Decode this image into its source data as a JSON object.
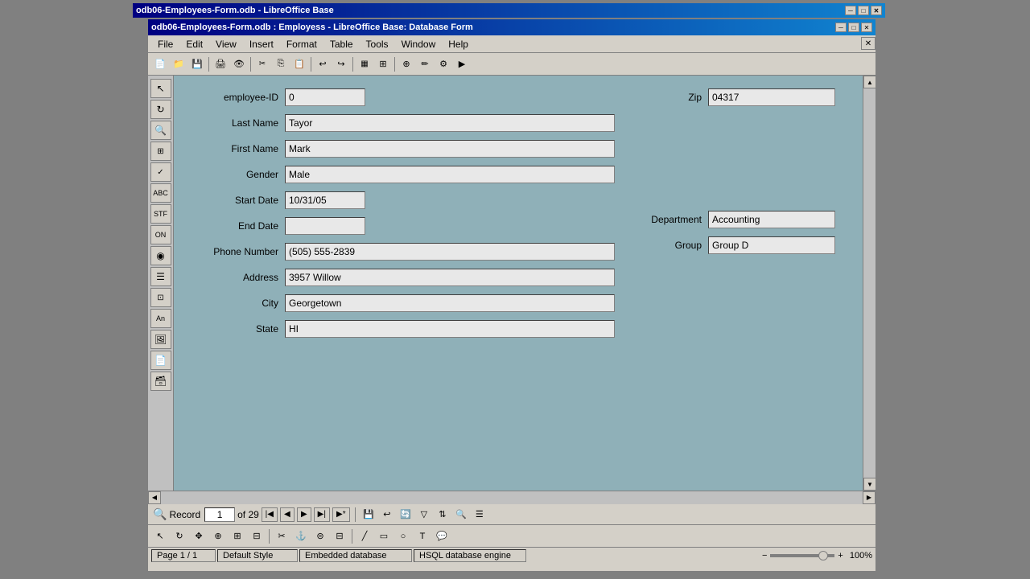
{
  "outer_window": {
    "title": "odb06-Employees-Form.odb - LibreOffice Base"
  },
  "inner_window": {
    "title": "odb06-Employees-Form.odb : Employess - LibreOffice Base: Database Form"
  },
  "menu": {
    "items": [
      "File",
      "Edit",
      "View",
      "Insert",
      "Format",
      "Table",
      "Tools",
      "Window",
      "Help"
    ]
  },
  "form": {
    "employee_id_label": "employee-ID",
    "employee_id_value": "0",
    "last_name_label": "Last Name",
    "last_name_value": "Tayor",
    "first_name_label": "First Name",
    "first_name_value": "Mark",
    "gender_label": "Gender",
    "gender_value": "Male",
    "start_date_label": "Start Date",
    "start_date_value": "10/31/05",
    "end_date_label": "End Date",
    "end_date_value": "",
    "phone_label": "Phone Number",
    "phone_value": "(505) 555-2839",
    "address_label": "Address",
    "address_value": "3957 Willow",
    "city_label": "City",
    "city_value": "Georgetown",
    "state_label": "State",
    "state_value": "HI",
    "zip_label": "Zip",
    "zip_value": "04317",
    "department_label": "Department",
    "department_value": "Accounting",
    "group_label": "Group",
    "group_value": "Group D"
  },
  "navigation": {
    "record_label": "Record",
    "record_value": "1",
    "of_text": "of 29",
    "nav_first": "⏮",
    "nav_prev": "◀",
    "nav_next": "▶",
    "nav_last": "⏭",
    "nav_new": "▶*"
  },
  "statusbar": {
    "page_text": "Page 1 / 1",
    "style_text": "Default Style",
    "db_text": "Embedded database",
    "engine_text": "HSQL database engine",
    "zoom_text": "100%"
  },
  "titlebar_buttons": {
    "minimize": "─",
    "maximize": "□",
    "close": "✕"
  }
}
